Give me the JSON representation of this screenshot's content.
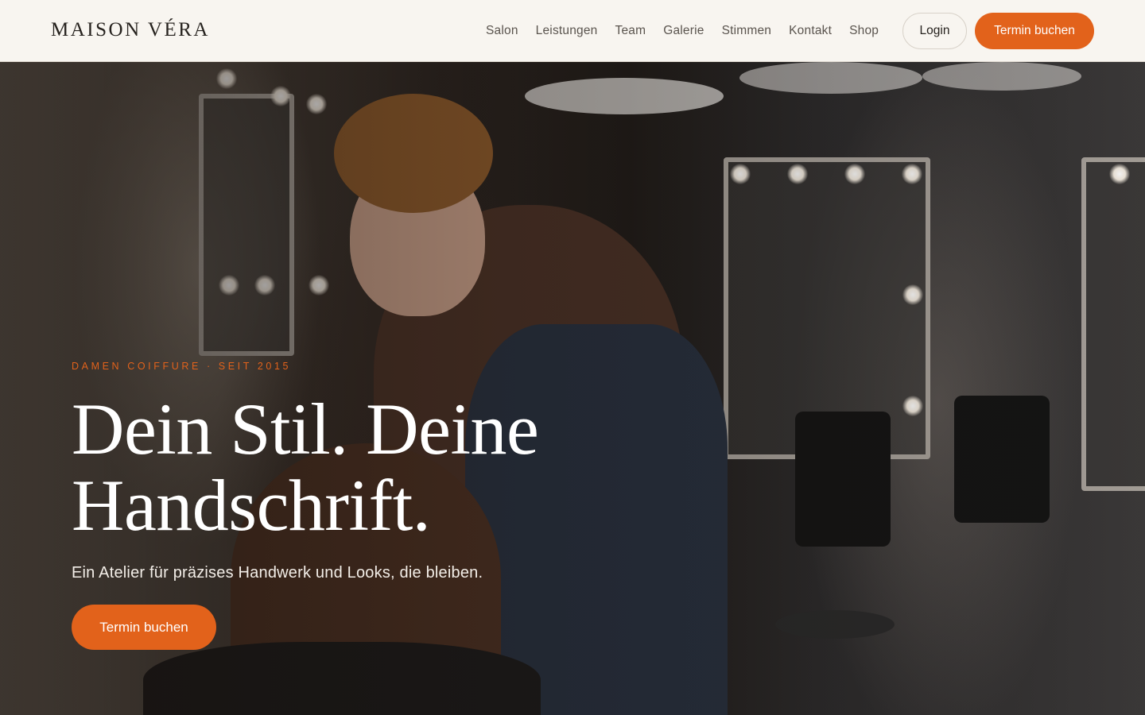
{
  "brand": {
    "name": "MAISON VÉRA"
  },
  "nav": {
    "items": [
      {
        "label": "Salon"
      },
      {
        "label": "Leistungen"
      },
      {
        "label": "Team"
      },
      {
        "label": "Galerie"
      },
      {
        "label": "Stimmen"
      },
      {
        "label": "Kontakt"
      },
      {
        "label": "Shop"
      }
    ],
    "login_label": "Login",
    "cta_label": "Termin buchen"
  },
  "hero": {
    "eyebrow": "DAMEN COIFFURE · SEIT 2015",
    "headline_line1": "Dein Stil. Deine",
    "headline_line2": "Handschrift.",
    "subline": "Ein Atelier für präzises Handwerk und Looks, die bleiben.",
    "cta_label": "Termin buchen",
    "image": "Friseurin schneidet Haare einer Kundin im Salon"
  },
  "colors": {
    "accent": "#e2621b",
    "header_bg": "#f8f5f0",
    "text_dark": "#26221e"
  }
}
